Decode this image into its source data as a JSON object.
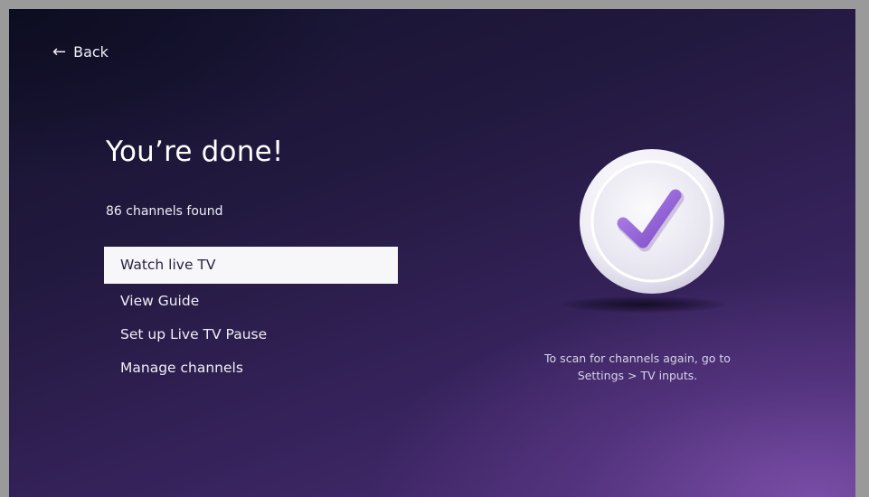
{
  "back": {
    "icon": "arrow-left-icon",
    "label": "Back"
  },
  "main": {
    "title": "You’re done!",
    "subtitle": "86 channels found"
  },
  "menu": {
    "items": [
      {
        "label": "Watch live TV",
        "selected": true
      },
      {
        "label": "View Guide",
        "selected": false
      },
      {
        "label": "Set up Live TV Pause",
        "selected": false
      },
      {
        "label": "Manage channels",
        "selected": false
      }
    ]
  },
  "illustration": {
    "icon": "checkmark-circle-icon",
    "accent_color": "#9b6bd6"
  },
  "hint": {
    "line1": "To scan for channels again, go to",
    "line2": "Settings > TV inputs."
  }
}
